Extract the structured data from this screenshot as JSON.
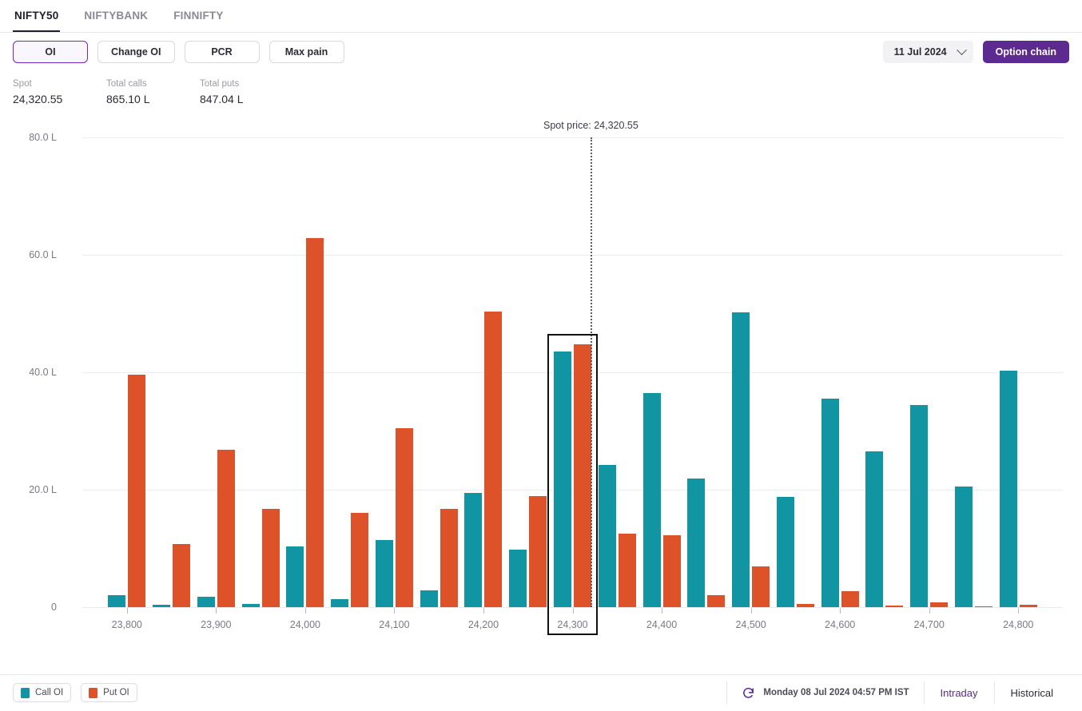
{
  "tabs": [
    {
      "label": "NIFTY50",
      "active": true
    },
    {
      "label": "NIFTYBANK",
      "active": false
    },
    {
      "label": "FINNIFTY",
      "active": false
    }
  ],
  "toolbar": {
    "modes": [
      {
        "label": "OI",
        "selected": true
      },
      {
        "label": "Change OI",
        "selected": false
      },
      {
        "label": "PCR",
        "selected": false
      },
      {
        "label": "Max pain",
        "selected": false
      }
    ],
    "expiry_value": "11 Jul 2024",
    "expiry_icon": "chevron-down-icon",
    "option_chain_label": "Option chain"
  },
  "stats": [
    {
      "label": "Spot",
      "value": "24,320.55"
    },
    {
      "label": "Total calls",
      "value": "865.10 L"
    },
    {
      "label": "Total puts",
      "value": "847.04 L"
    }
  ],
  "legend": [
    {
      "label": "Call OI",
      "color": "#1295a3",
      "swatch": "call-oi-swatch"
    },
    {
      "label": "Put OI",
      "color": "#dd5228",
      "swatch": "put-oi-swatch"
    }
  ],
  "footer": {
    "refresh_icon": "refresh-icon",
    "timestamp": "Monday 08 Jul 2024 04:57 PM IST",
    "intraday_label": "Intraday",
    "historical_label": "Historical"
  },
  "colors": {
    "call": "#1295a3",
    "put": "#dd5228",
    "accent": "#5d2a91",
    "accent_light": "#7826c4",
    "highlight_border": "#111111"
  },
  "chart_data": {
    "type": "bar",
    "title": "",
    "xlabel": "",
    "ylabel": "",
    "grid": true,
    "legend_position": "bottom-left",
    "ylim": [
      0,
      80
    ],
    "yticks": [
      0,
      20,
      40,
      60,
      80
    ],
    "ytick_labels": [
      "0",
      "20.0 L",
      "40.0 L",
      "60.0 L",
      "80.0 L"
    ],
    "unit": "L",
    "x_major_labels": [
      "23,800",
      "23,900",
      "24,000",
      "24,100",
      "24,200",
      "24,300",
      "24,400",
      "24,500",
      "24,600",
      "24,700",
      "24,800"
    ],
    "categories": [
      23800,
      23850,
      23900,
      23950,
      24000,
      24050,
      24100,
      24150,
      24200,
      24250,
      24300,
      24350,
      24400,
      24450,
      24500,
      24550,
      24600,
      24650,
      24700,
      24750,
      24800
    ],
    "series": [
      {
        "name": "Call OI",
        "color": "#1295a3",
        "values": [
          2.1,
          0.4,
          1.8,
          0.5,
          10.3,
          1.3,
          11.4,
          2.9,
          19.5,
          9.8,
          43.5,
          24.2,
          36.5,
          21.9,
          50.2,
          18.8,
          35.5,
          26.6,
          34.4,
          20.6,
          40.3
        ]
      },
      {
        "name": "Put OI",
        "color": "#dd5228",
        "values": [
          39.6,
          10.7,
          26.8,
          16.7,
          62.9,
          16.1,
          30.5,
          16.8,
          50.3,
          18.9,
          44.8,
          12.5,
          12.3,
          2.0,
          7.0,
          0.6,
          2.7,
          0.3,
          0.8,
          0.1,
          0.4
        ]
      }
    ],
    "annotations": [
      {
        "type": "vline",
        "name": "spot-price-line",
        "x": 24320.55,
        "label": "Spot price: 24,320.55",
        "style": "dotted"
      },
      {
        "type": "highlight",
        "name": "selected-strike-box",
        "x": 24300,
        "label": "24,300"
      }
    ],
    "spot_price": 24320.55,
    "spot_label": "Spot price: 24,320.55",
    "selected_strike": "24,300"
  }
}
